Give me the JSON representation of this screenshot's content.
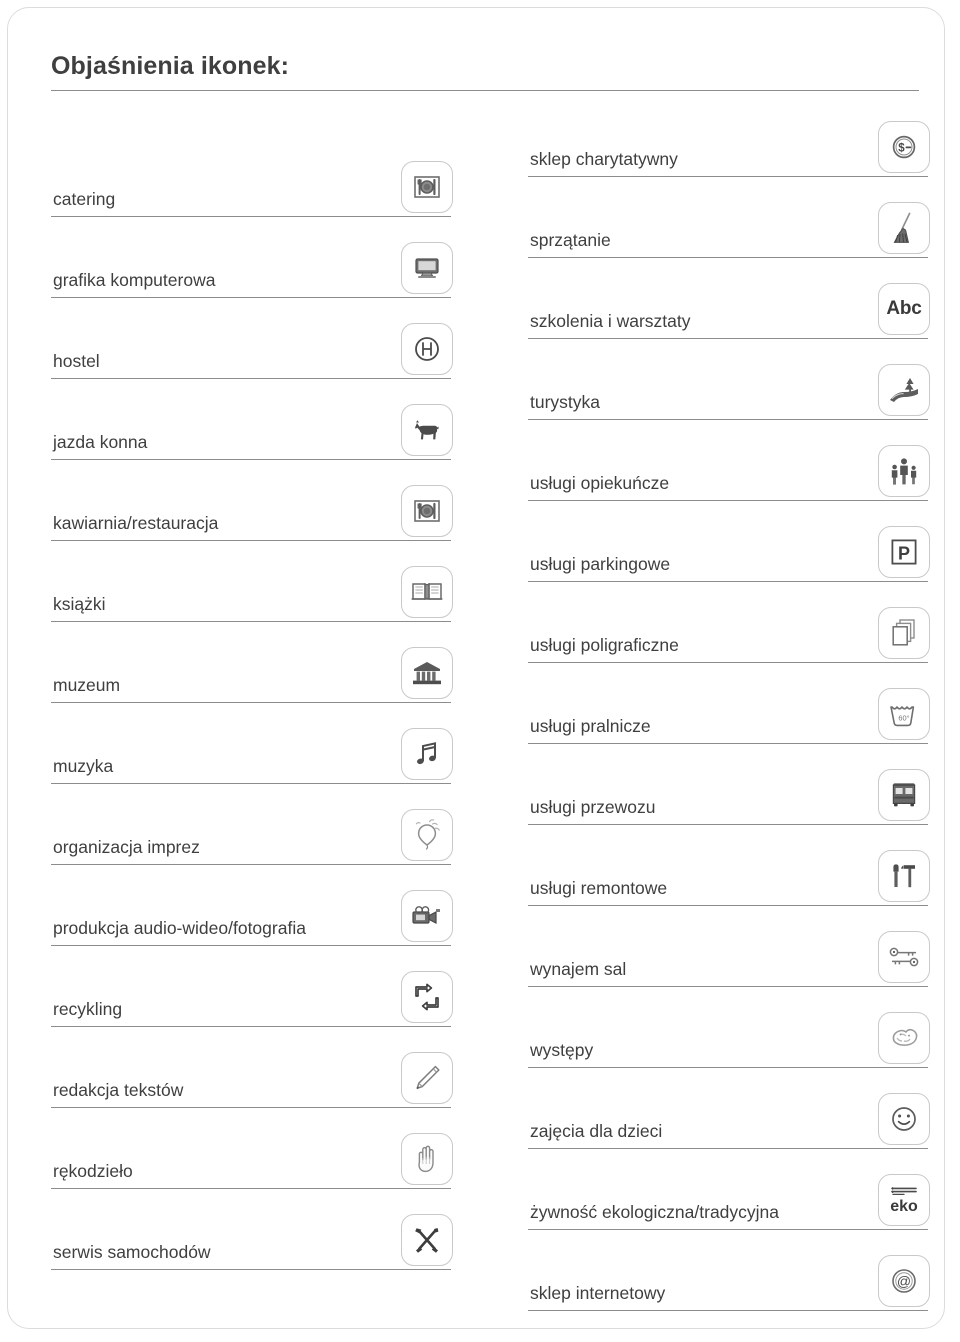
{
  "page": {
    "title": "Objaśnienia ikonek:",
    "accent_color": "#3f3f3f",
    "rule_color": "#8d8d8d",
    "tile_border_color": "#c9c9c9",
    "background_color": "#ffffff"
  },
  "legend": {
    "left_column": [
      {
        "label": "catering",
        "icon": "plate-cutlery-icon"
      },
      {
        "label": "grafika komputerowa",
        "icon": "computer-monitor-icon"
      },
      {
        "label": "hostel",
        "icon": "circled-h-icon"
      },
      {
        "label": "jazda konna",
        "icon": "horse-icon"
      },
      {
        "label": "kawiarnia/restauracja",
        "icon": "plate-cutlery-icon"
      },
      {
        "label": "książki",
        "icon": "open-book-icon"
      },
      {
        "label": "muzeum",
        "icon": "museum-building-icon"
      },
      {
        "label": "muzyka",
        "icon": "music-notes-icon"
      },
      {
        "label": "organizacja imprez",
        "icon": "balloon-icon"
      },
      {
        "label": "produkcja audio-wideo/fotografia",
        "icon": "video-camera-icon"
      },
      {
        "label": "recykling",
        "icon": "recycling-arrows-icon"
      },
      {
        "label": "redakcja tekstów",
        "icon": "pen-icon"
      },
      {
        "label": "rękodzieło",
        "icon": "open-hand-icon"
      },
      {
        "label": "serwis samochodów",
        "icon": "hammer-wrench-icon"
      }
    ],
    "right_column": [
      {
        "label": "sklep charytatywny",
        "icon": "coin-dollar-icon"
      },
      {
        "label": "sprzątanie",
        "icon": "broom-icon"
      },
      {
        "label": "szkolenia i warsztaty",
        "icon": "abc-text-icon",
        "glyph": "Abc"
      },
      {
        "label": "turystyka",
        "icon": "trail-tree-icon"
      },
      {
        "label": "usługi opiekuńcze",
        "icon": "family-people-icon"
      },
      {
        "label": "usługi parkingowe",
        "icon": "parking-p-icon",
        "glyph": "P"
      },
      {
        "label": "usługi poligraficzne",
        "icon": "paper-stack-icon"
      },
      {
        "label": "usługi pralnicze",
        "icon": "wash-tub-icon",
        "glyph": "60°"
      },
      {
        "label": "usługi przewozu",
        "icon": "bus-icon"
      },
      {
        "label": "usługi remontowe",
        "icon": "brush-hammer-icon"
      },
      {
        "label": "wynajem sal",
        "icon": "keys-icon"
      },
      {
        "label": "występy",
        "icon": "performance-icon"
      },
      {
        "label": "zajęcia dla dzieci",
        "icon": "smiley-face-icon"
      },
      {
        "label": "żywność ekologiczna/tradycyjna",
        "icon": "eko-food-icon",
        "glyph": "eko"
      },
      {
        "label": "sklep internetowy",
        "icon": "at-sign-icon"
      }
    ]
  }
}
